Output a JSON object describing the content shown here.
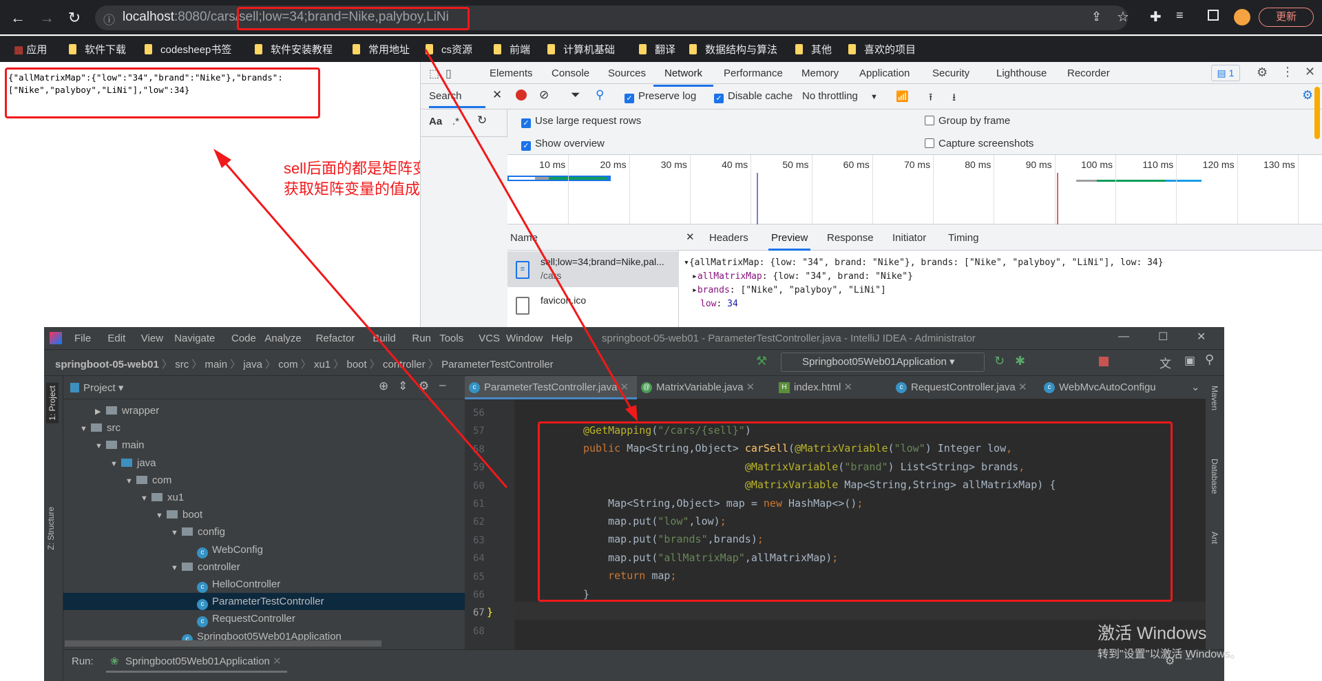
{
  "browser": {
    "url_host": "localhost",
    "url_rest": ":8080/cars/sell;low=34;brand=Nike,palyboy,LiNi",
    "update_label": "更新",
    "bookmarks": [
      "应用",
      "软件下载",
      "codesheep书签",
      "软件安装教程",
      "常用地址",
      "cs资源",
      "前端",
      "计算机基础",
      "翻译",
      "数据结构与算法",
      "其他",
      "喜欢的项目"
    ]
  },
  "page": {
    "json_line1": "{\"allMatrixMap\":{\"low\":\"34\",\"brand\":\"Nike\"},\"brands\":",
    "json_line2": "[\"Nike\",\"palyboy\",\"LiNi\"],\"low\":34}"
  },
  "annotation": {
    "line1": "sell后面的都是矩阵变量,",
    "line2": "获取矩阵变量的值成功",
    "color": "#f0191b"
  },
  "devtools": {
    "tabs": [
      "Elements",
      "Console",
      "Sources",
      "Network",
      "Performance",
      "Memory",
      "Application",
      "Security",
      "Lighthouse",
      "Recorder"
    ],
    "active_tab": "Network",
    "issues_count": "1",
    "search_label": "Search",
    "aa_label": "Aa",
    "regex_label": ".*",
    "preserve_log": "Preserve log",
    "disable_cache": "Disable cache",
    "throttling": "No throttling",
    "options": {
      "large_rows": "Use large request rows",
      "show_overview": "Show overview",
      "group_by_frame": "Group by frame",
      "capture_screenshots": "Capture screenshots"
    },
    "ticks": [
      "10 ms",
      "20 ms",
      "30 ms",
      "40 ms",
      "50 ms",
      "60 ms",
      "70 ms",
      "80 ms",
      "90 ms",
      "100 ms",
      "110 ms",
      "120 ms",
      "130 ms"
    ],
    "name_header": "Name",
    "requests": [
      {
        "name": "sell;low=34;brand=Nike,pal...",
        "path": "/cars"
      },
      {
        "name": "favicon.ico",
        "path": ""
      }
    ],
    "detail_tabs": [
      "Headers",
      "Preview",
      "Response",
      "Initiator",
      "Timing"
    ],
    "active_detail": "Preview",
    "preview": {
      "root": "{allMatrixMap: {low: \"34\", brand: \"Nike\"}, brands: [\"Nike\", \"palyboy\", \"LiNi\"], low: 34}",
      "k1": "allMatrixMap",
      "v1": "{low: \"34\", brand: \"Nike\"}",
      "k2": "brands",
      "v2": "[\"Nike\", \"palyboy\", \"LiNi\"]",
      "k3": "low",
      "v3": "34"
    }
  },
  "ide": {
    "menu": [
      "File",
      "Edit",
      "View",
      "Navigate",
      "Code",
      "Analyze",
      "Refactor",
      "Build",
      "Run",
      "Tools",
      "VCS",
      "Window",
      "Help"
    ],
    "title": "springboot-05-web01 - ParameterTestController.java - IntelliJ IDEA - Administrator",
    "breadcrumb": [
      "springboot-05-web01",
      "src",
      "main",
      "java",
      "com",
      "xu1",
      "boot",
      "controller",
      "ParameterTestController"
    ],
    "run_config": "Springboot05Web01Application",
    "project_label": "Project",
    "file_tabs": [
      "ParameterTestController.java",
      "MatrixVariable.java",
      "index.html",
      "RequestController.java",
      "WebMvcAutoConfigu"
    ],
    "tree": [
      {
        "label": "wrapper",
        "depth": 2,
        "type": "folder",
        "open": false
      },
      {
        "label": "src",
        "depth": 1,
        "type": "folder",
        "open": true
      },
      {
        "label": "main",
        "depth": 2,
        "type": "folder",
        "open": true
      },
      {
        "label": "java",
        "depth": 3,
        "type": "source",
        "open": true
      },
      {
        "label": "com",
        "depth": 4,
        "type": "package",
        "open": true
      },
      {
        "label": "xu1",
        "depth": 5,
        "type": "package",
        "open": true
      },
      {
        "label": "boot",
        "depth": 6,
        "type": "package",
        "open": true
      },
      {
        "label": "config",
        "depth": 7,
        "type": "package",
        "open": true
      },
      {
        "label": "WebConfig",
        "depth": 8,
        "type": "class"
      },
      {
        "label": "controller",
        "depth": 7,
        "type": "package",
        "open": true
      },
      {
        "label": "HelloController",
        "depth": 8,
        "type": "class"
      },
      {
        "label": "ParameterTestController",
        "depth": 8,
        "type": "class",
        "selected": true
      },
      {
        "label": "RequestController",
        "depth": 8,
        "type": "class"
      },
      {
        "label": "Springboot05Web01Application",
        "depth": 7,
        "type": "app"
      }
    ],
    "line_numbers": [
      "56",
      "57",
      "58",
      "59",
      "60",
      "61",
      "62",
      "63",
      "64",
      "65",
      "66",
      "67",
      "68"
    ],
    "side_left": [
      "1: Project",
      "Z: Structure"
    ],
    "side_right": [
      "Maven",
      "Database",
      "Ant"
    ],
    "run_label": "Run:",
    "run_tab": "Springboot05Web01Application"
  },
  "watermark": {
    "line1": "激活 Windows",
    "line2": "转到\"设置\"以激活 Windows。"
  }
}
